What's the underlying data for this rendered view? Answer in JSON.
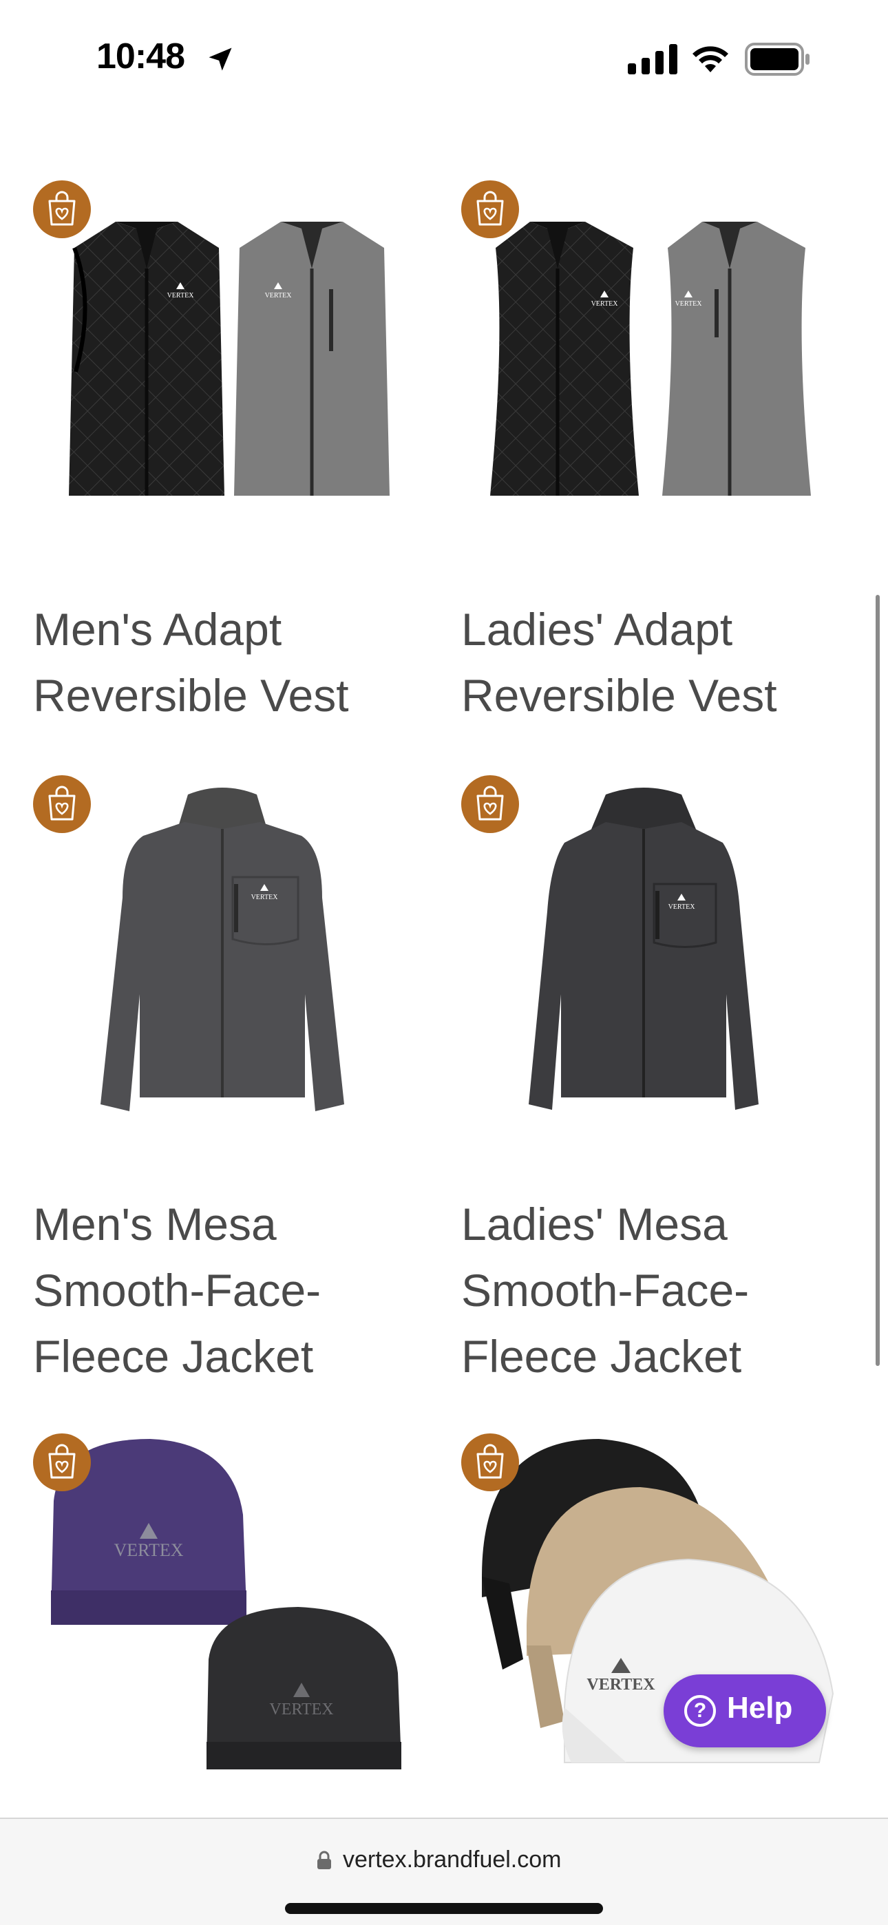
{
  "status_bar": {
    "time": "10:48",
    "icons": [
      "location-arrow-icon",
      "cellular-signal-icon",
      "wifi-icon",
      "battery-icon"
    ]
  },
  "products": [
    {
      "title": "Men's Adapt Reversible Vest",
      "image": "mens-vest-pair"
    },
    {
      "title": "Ladies' Adapt Reversible Vest",
      "image": "ladies-vest-pair"
    },
    {
      "title": "Men's Mesa Smooth-Face-Fleece Jacket",
      "image": "mens-fleece-jacket"
    },
    {
      "title": "Ladies' Mesa Smooth-Face-Fleece Jacket",
      "image": "ladies-fleece-jacket"
    },
    {
      "title": "",
      "image": "knit-beanies"
    },
    {
      "title": "",
      "image": "baseball-caps"
    }
  ],
  "logo_text": "VERTEX",
  "help_button": {
    "label": "Help",
    "icon": "question-circle-icon"
  },
  "url_bar": {
    "url": "vertex.brandfuel.com",
    "icon": "lock-icon"
  },
  "colors": {
    "wishlist_badge": "#b36b22",
    "help_button": "#7a3ed6"
  }
}
